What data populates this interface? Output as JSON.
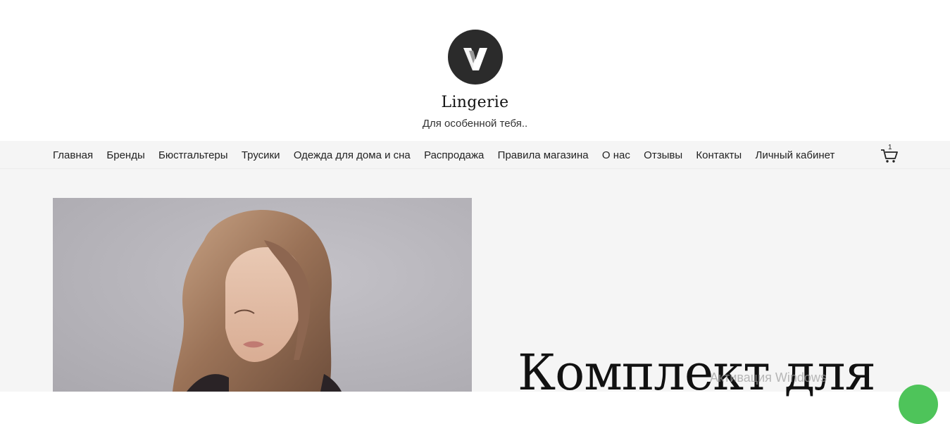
{
  "header": {
    "site_title": "Lingerie",
    "tagline": "Для особенной тебя.."
  },
  "nav": {
    "items": [
      {
        "label": "Главная"
      },
      {
        "label": "Бренды"
      },
      {
        "label": "Бюстгальтеры"
      },
      {
        "label": "Трусики"
      },
      {
        "label": "Одежда для дома и сна"
      },
      {
        "label": "Распродажа"
      },
      {
        "label": "Правила магазина"
      },
      {
        "label": "О нас"
      },
      {
        "label": "Отзывы"
      },
      {
        "label": "Контакты"
      },
      {
        "label": "Личный кабинет"
      }
    ],
    "cart_count": "1",
    "cart_icon": "cart-icon"
  },
  "hero": {
    "title": "Комплект для",
    "image_icon": "model-photo"
  },
  "overlay": {
    "watermark": "Активация Windows"
  },
  "colors": {
    "logo_bg": "#2b2b2b",
    "nav_bg": "#f5f5f5",
    "main_bg": "#f5f5f5",
    "chat_green": "#4ec45a"
  }
}
